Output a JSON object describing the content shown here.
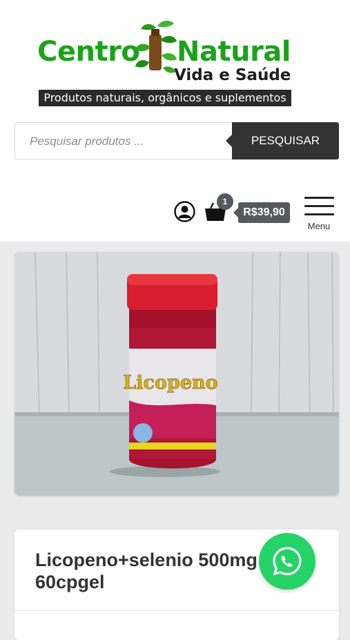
{
  "brand": {
    "name_part1": "Centro",
    "name_part2": "Natural",
    "subtitle": "Vida e Saúde",
    "tagline": "Produtos naturais, orgânicos e suplementos"
  },
  "search": {
    "placeholder": "Pesquisar produtos ...",
    "button_label": "PESQUISAR"
  },
  "header_actions": {
    "cart_count": "1",
    "cart_total": "R$39,90",
    "menu_label": "Menu"
  },
  "product": {
    "image_label": "Licopeno",
    "title": "Licopeno+selenio 500mg 60cpgel"
  },
  "icons": {
    "account": "account-icon",
    "cart": "shopping-basket-icon",
    "menu": "hamburger-menu-icon",
    "whatsapp": "whatsapp-icon"
  },
  "colors": {
    "brand_green": "#1aa31a",
    "dark": "#333333",
    "badge": "#555a5f",
    "whatsapp": "#25d366"
  }
}
